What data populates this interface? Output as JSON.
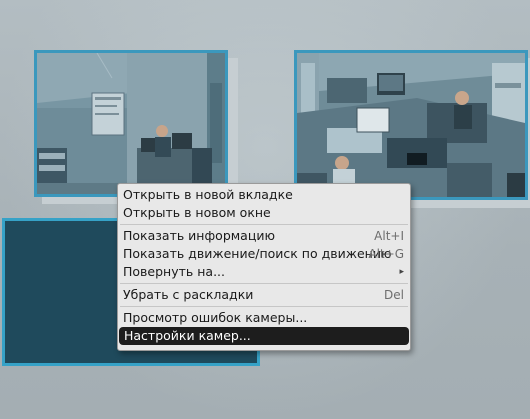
{
  "context_menu": {
    "items": [
      {
        "label": "Открыть в новой вкладке",
        "shortcut": ""
      },
      {
        "label": "Открыть в новом окне",
        "shortcut": ""
      },
      {
        "label": "Показать информацию",
        "shortcut": "Alt+I"
      },
      {
        "label": "Показать движение/поиск по движению",
        "shortcut": "Alt+G"
      },
      {
        "label": "Повернуть на...",
        "submenu_icon": "triangle-right-icon"
      },
      {
        "label": "Убрать с раскладки",
        "shortcut": "Del"
      },
      {
        "label": "Просмотр ошибок камеры...",
        "shortcut": ""
      },
      {
        "label": "Настройки камер...",
        "shortcut": "",
        "highlighted": true
      }
    ]
  },
  "colors": {
    "tile_border": "#3b98bd",
    "empty_tile": "#1f4a5c",
    "menu_bg": "#e8e8e8",
    "menu_highlight": "#1d1d1d"
  }
}
